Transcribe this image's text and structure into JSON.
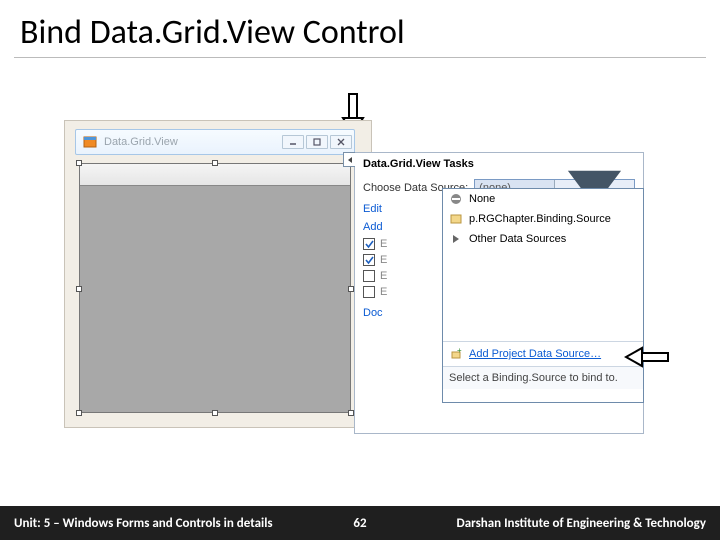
{
  "slide": {
    "title": "Bind Data.Grid.View Control"
  },
  "window": {
    "title": "Data.Grid.View"
  },
  "tasks": {
    "title": "Data.Grid.View Tasks",
    "choose_ds_label": "Choose Data Source:",
    "ds_value": "(none)",
    "links": {
      "edit": "Edit",
      "add": "Add",
      "dock": "Doc"
    },
    "cb_prefix": "E"
  },
  "dropdown": {
    "items": [
      {
        "label": "None",
        "icon": "none"
      },
      {
        "label": "p.RGChapter.Binding.Source",
        "icon": "bs"
      },
      {
        "label": "Other Data Sources",
        "icon": "expand"
      }
    ],
    "add_link": "Add Project Data Source…",
    "hint": "Select a Binding.Source to bind to."
  },
  "footer": {
    "unit": "Unit: 5 – Windows Forms and Controls in details",
    "page": "62",
    "institute": "Darshan Institute of Engineering & Technology"
  }
}
